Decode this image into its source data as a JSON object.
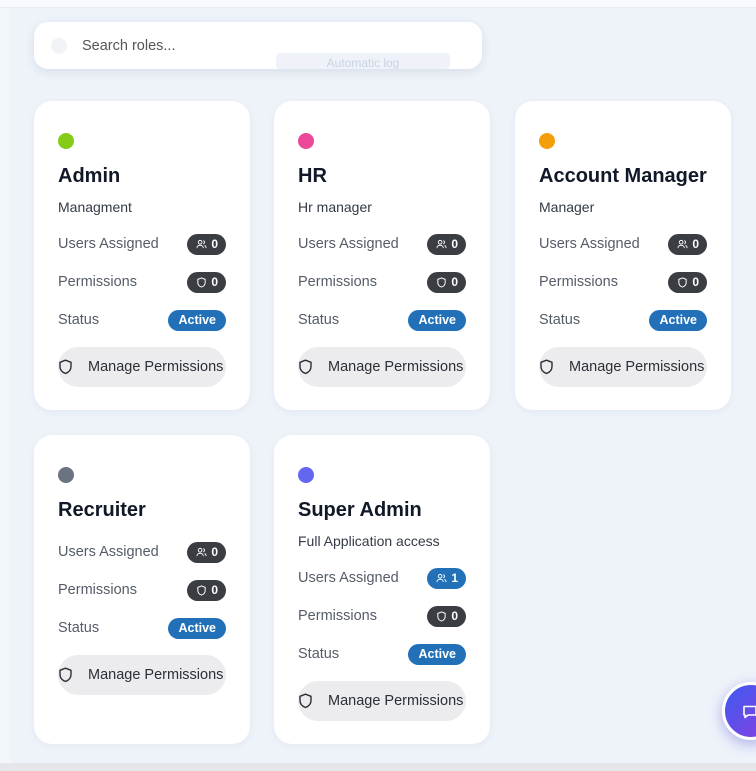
{
  "search": {
    "placeholder": "Search roles...",
    "ghost_label": "Automatic log"
  },
  "labels": {
    "users_assigned": "Users Assigned",
    "permissions": "Permissions",
    "status": "Status",
    "manage_permissions": "Manage Permissions"
  },
  "roles": [
    {
      "name": "Admin",
      "description": "Managment",
      "users": "0",
      "permissions": "0",
      "status": "Active",
      "color": "#84cc16"
    },
    {
      "name": "HR",
      "description": "Hr manager",
      "users": "0",
      "permissions": "0",
      "status": "Active",
      "color": "#ec4899"
    },
    {
      "name": "Account Manager",
      "description": "Manager",
      "users": "0",
      "permissions": "0",
      "status": "Active",
      "color": "#f59e0b"
    },
    {
      "name": "Recruiter",
      "description": "",
      "users": "0",
      "permissions": "0",
      "status": "Active",
      "color": "#6b7280"
    },
    {
      "name": "Super Admin",
      "description": "Full Application access",
      "users": "1",
      "permissions": "0",
      "status": "Active",
      "color": "#6366f1"
    }
  ],
  "icons": {
    "search": "search-icon",
    "users": "users-icon",
    "permissions": "shield-icon",
    "manage": "shield-icon",
    "chat": "chat-icon"
  }
}
